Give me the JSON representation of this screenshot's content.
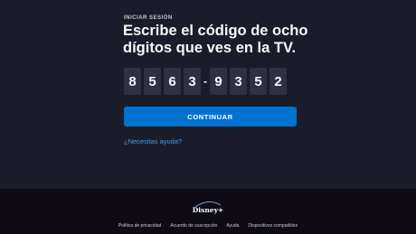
{
  "header": {
    "eyebrow": "INICIAR SESIÓN",
    "title": "Escribe el código de ocho dígitos que ves en la TV."
  },
  "code": {
    "digits": [
      "8",
      "5",
      "6",
      "3",
      "9",
      "3",
      "5",
      "2"
    ],
    "separator": "-"
  },
  "actions": {
    "continue_label": "CONTINUAR",
    "help_link": "¿Necesitas ayuda?"
  },
  "footer": {
    "brand": "Disney+",
    "links": [
      "Política de privacidad",
      "Acuerdo de suscripción",
      "Ayuda",
      "Dispositivos compatibles"
    ]
  },
  "colors": {
    "background": "#1a1d29",
    "footer_background": "#0e0b14",
    "accent": "#0072d2",
    "link": "#3a9df0",
    "code_box": "#2e3240"
  }
}
